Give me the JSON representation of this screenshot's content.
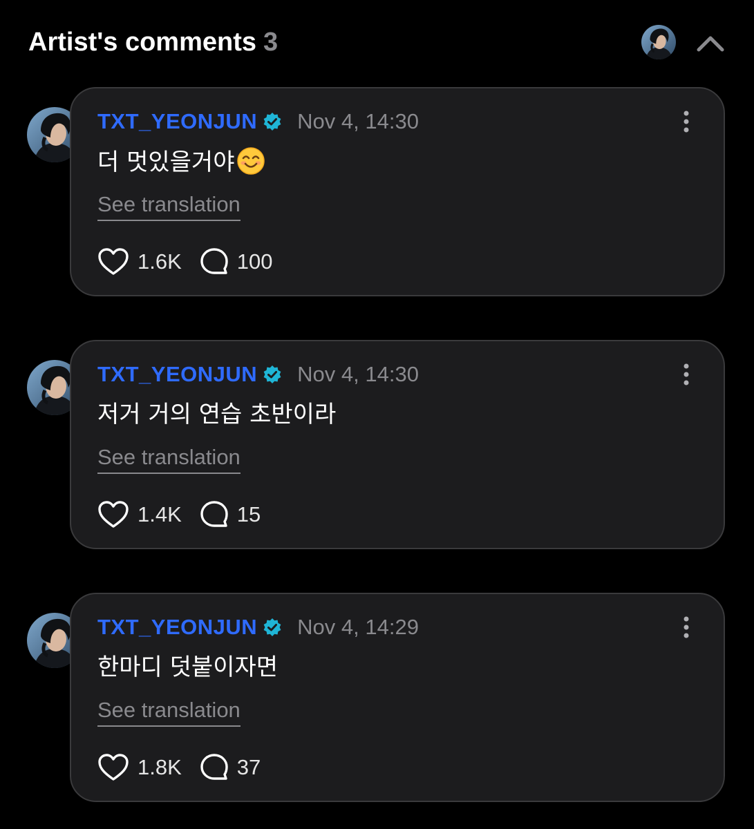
{
  "header": {
    "title": "Artist's comments",
    "count": "3",
    "avatar_icon": "artist-avatar",
    "collapse_icon": "chevron-up-icon"
  },
  "colors": {
    "background": "#000000",
    "card": "#1c1c1e",
    "card_border": "#3a3a3c",
    "username": "#2f6bff",
    "verified": "#1fb5d6",
    "muted": "#8a8a8e"
  },
  "comments": [
    {
      "username": "TXT_YEONJUN",
      "timestamp": "Nov 4, 14:30",
      "text": "더 멋있을거야",
      "emoji": "smiling-face-emoji",
      "translate_label": "See translation",
      "likes": "1.6K",
      "replies": "100"
    },
    {
      "username": "TXT_YEONJUN",
      "timestamp": "Nov 4, 14:30",
      "text": "저거 거의 연습 초반이라",
      "translate_label": "See translation",
      "likes": "1.4K",
      "replies": "15"
    },
    {
      "username": "TXT_YEONJUN",
      "timestamp": "Nov 4, 14:29",
      "text": "한마디 덧붙이자면",
      "translate_label": "See translation",
      "likes": "1.8K",
      "replies": "37"
    }
  ]
}
